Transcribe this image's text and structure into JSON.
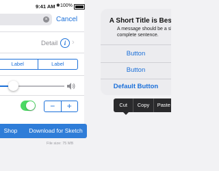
{
  "status": {
    "time": "9:41 AM",
    "battery": "100%"
  },
  "search": {
    "cancel": "Cancel"
  },
  "table": {
    "detail": "Detail"
  },
  "segmented": {
    "items": [
      "Label",
      "Label"
    ]
  },
  "slider": {
    "value": 0.2
  },
  "stepper": {
    "minus": "−",
    "plus": "+"
  },
  "toggle": {
    "on": true
  },
  "alert": {
    "title": "A Short Title is Best",
    "message": "A message should be a short, complete sentence.",
    "buttons": [
      "Button",
      "Button",
      "Default Button"
    ]
  },
  "edit_menu": {
    "items": [
      "Cut",
      "Copy",
      "Paste"
    ]
  },
  "downloads": {
    "shop_label": "Shop",
    "sketch_label": "Download for Sketch",
    "file_size": "File size: 75 MB"
  },
  "colors": {
    "accent": "#1a6fd9",
    "toggle_on": "#4cd964",
    "button_blue": "#2f7dd8"
  }
}
